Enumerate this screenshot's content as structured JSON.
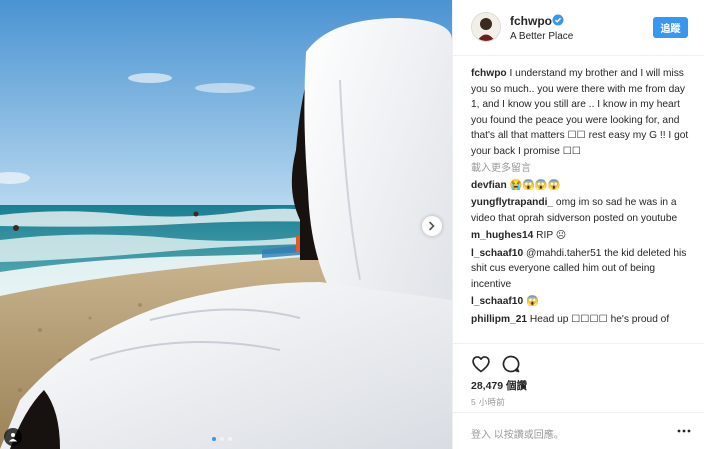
{
  "post": {
    "author": "fchwpo",
    "location": "A Better Place",
    "follow_label": "追蹤",
    "caption_user": "fchwpo",
    "caption_text": "I understand my brother and I will miss you so much.. you were there with me from day 1, and I know you still are .. I know in my heart you found the peace you were looking for, and that's all that matters ☐☐ rest easy my G !! I got your back I promise ☐☐",
    "load_more": "載入更多留言",
    "comments": [
      {
        "user": "devfian",
        "text": "😭😱😱😱"
      },
      {
        "user": "yungflytrapandi_",
        "text": "omg im so sad he was in a video that oprah sidverson posted on youtube"
      },
      {
        "user": "m_hughes14",
        "text": "RIP ☹"
      },
      {
        "user": "l_schaaf10",
        "text": "@mahdi.taher51 the kid deleted his shit cus everyone called him out of being incentive"
      },
      {
        "user": "l_schaaf10",
        "text": "😱"
      },
      {
        "user": "phillipm_21",
        "text": "Head up ☐☐☐☐ he's proud of"
      }
    ],
    "likes": "28,479 個讚",
    "time": "5 小時前",
    "comment_placeholder": "留 入 以按讚或回應。",
    "comment_placeholder_display": "登入 以按讚或回應。"
  },
  "carousel": {
    "total": 3,
    "active": 0
  },
  "colors": {
    "accent": "#3897f0",
    "muted": "#999999",
    "border": "#efefef"
  },
  "icons": [
    "chevron-right-icon",
    "user-tag-icon",
    "verified-badge-icon",
    "heart-icon",
    "comment-icon",
    "more-options-icon"
  ]
}
